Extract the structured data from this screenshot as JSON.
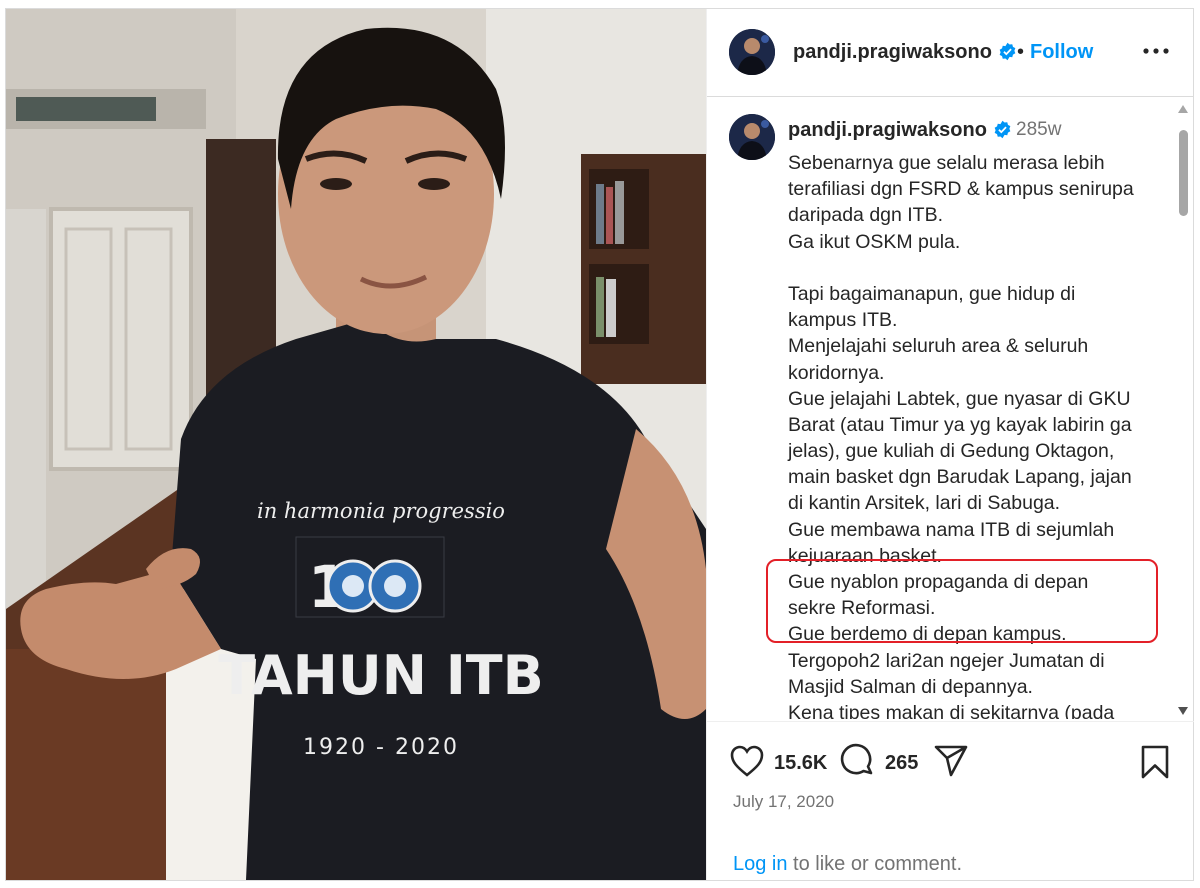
{
  "post": {
    "username": "pandji.pragiwaksono",
    "follow_label": "Follow",
    "separator": "•",
    "time_ago": "285w",
    "caption_lines": [
      "Sebenarnya gue selalu merasa lebih",
      "terafiliasi dgn FSRD & kampus senirupa",
      "daripada dgn ITB.",
      "Ga ikut OSKM pula.",
      "",
      "Tapi bagaimanapun, gue hidup di",
      "kampus ITB.",
      "Menjelajahi seluruh area & seluruh",
      "koridornya.",
      "Gue jelajahi Labtek, gue nyasar di GKU",
      "Barat (atau Timur ya yg kayak labirin ga",
      "jelas), gue kuliah di Gedung Oktagon,",
      "main basket dgn Barudak Lapang, jajan",
      "di kantin Arsitek, lari di Sabuga.",
      "Gue membawa nama ITB di sejumlah",
      "kejuaraan basket.",
      "Gue nyablon propaganda di depan",
      "sekre Reformasi.",
      "Gue berdemo di depan kampus.",
      "Tergopoh2 lari2an ngejer Jumatan di",
      "Masjid Salman di depannya.",
      "Kena tipes makan di sekitarnya (pada"
    ],
    "likes": "15.6K",
    "comments": "265",
    "date": "July 17, 2020",
    "login_link": "Log in",
    "login_suffix": " to like or comment."
  },
  "photo": {
    "shirt_text_top": "in harmonia progressio",
    "shirt_text_main": "TAHUN ITB",
    "shirt_years": "1920 - 2020",
    "shirt_number_one": "1"
  },
  "icons": {
    "verified": "verified-badge-icon",
    "more": "more-options-icon",
    "like": "heart-icon",
    "comment": "comment-icon",
    "share": "share-icon",
    "save": "bookmark-icon"
  },
  "colors": {
    "accent": "#0095f6",
    "highlight": "#e32028",
    "muted_text": "#737373"
  }
}
